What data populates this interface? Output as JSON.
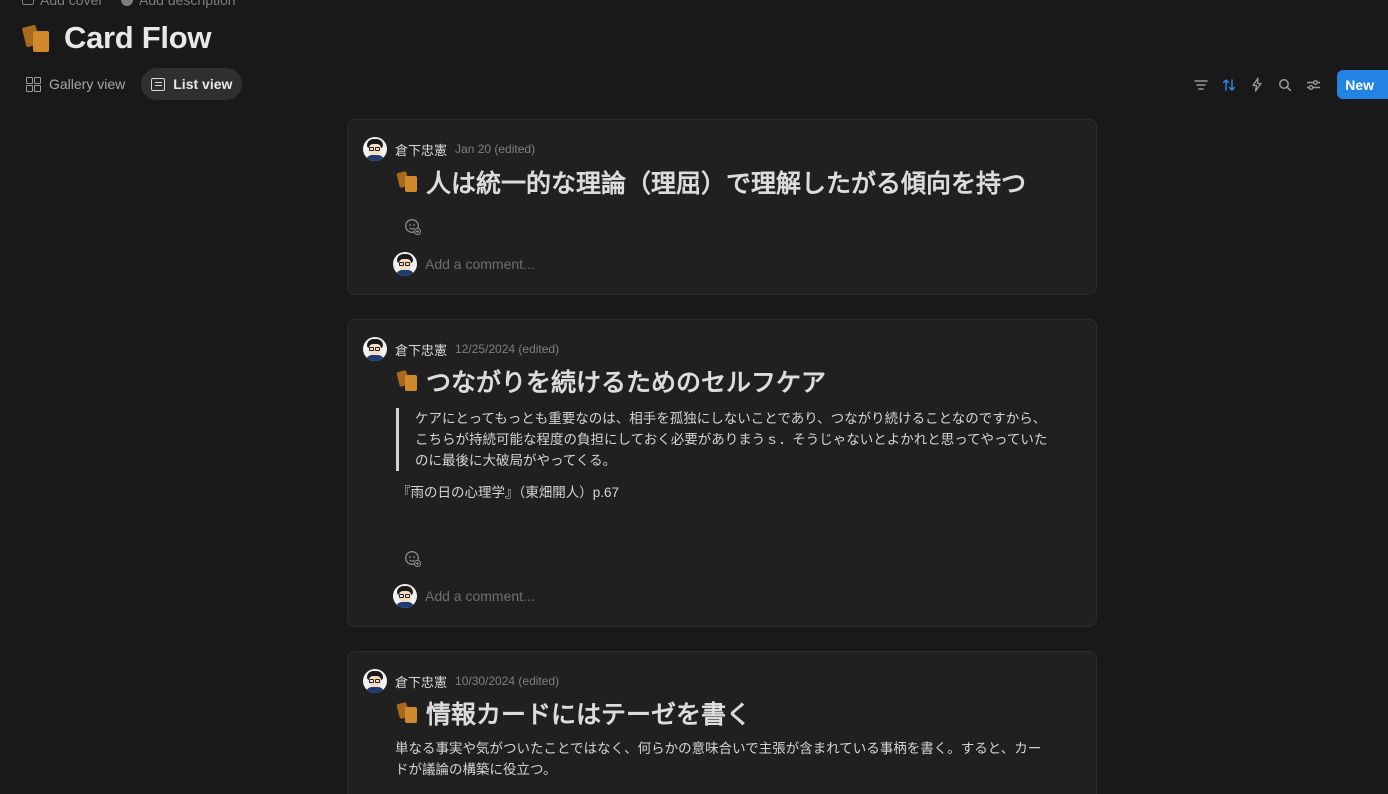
{
  "header": {
    "add_cover": "Add cover",
    "add_description": "Add description",
    "title": "Card Flow",
    "title_icon": "cards-icon"
  },
  "views": [
    {
      "label": "Gallery view",
      "icon": "gallery-grid-icon",
      "active": false
    },
    {
      "label": "List view",
      "icon": "list-view-icon",
      "active": true
    }
  ],
  "toolbar": {
    "filter_icon": "filter-icon",
    "sort_icon": "sort-icon",
    "automation_icon": "lightning-icon",
    "search_icon": "search-icon",
    "settings_icon": "sliders-icon",
    "new_label": "New"
  },
  "accent_color": "#2383e2",
  "cards": [
    {
      "author": "倉下忠憲",
      "date": "Jan 20 (edited)",
      "title": "人は統一的な理論（理屈）で理解したがる傾向を持つ",
      "comment_placeholder": "Add a comment..."
    },
    {
      "author": "倉下忠憲",
      "date": "12/25/2024 (edited)",
      "title": "つながりを続けるためのセルフケア",
      "quote": "ケアにとってもっとも重要なのは、相手を孤独にしないことであり、つながり続けることなのですから、こちらが持続可能な程度の負担にしておく必要がありまうｓ．そうじゃないとよかれと思ってやっていたのに最後に大破局がやってくる。",
      "source": "『雨の日の心理学』（東畑開人）p.67",
      "comment_placeholder": "Add a comment..."
    },
    {
      "author": "倉下忠憲",
      "date": "10/30/2024 (edited)",
      "title": "情報カードにはテーゼを書く",
      "body": "単なる事実や気がついたことではなく、何らかの意味合いで主張が含まれている事柄を書く。すると、カードが議論の構築に役立つ。"
    }
  ]
}
